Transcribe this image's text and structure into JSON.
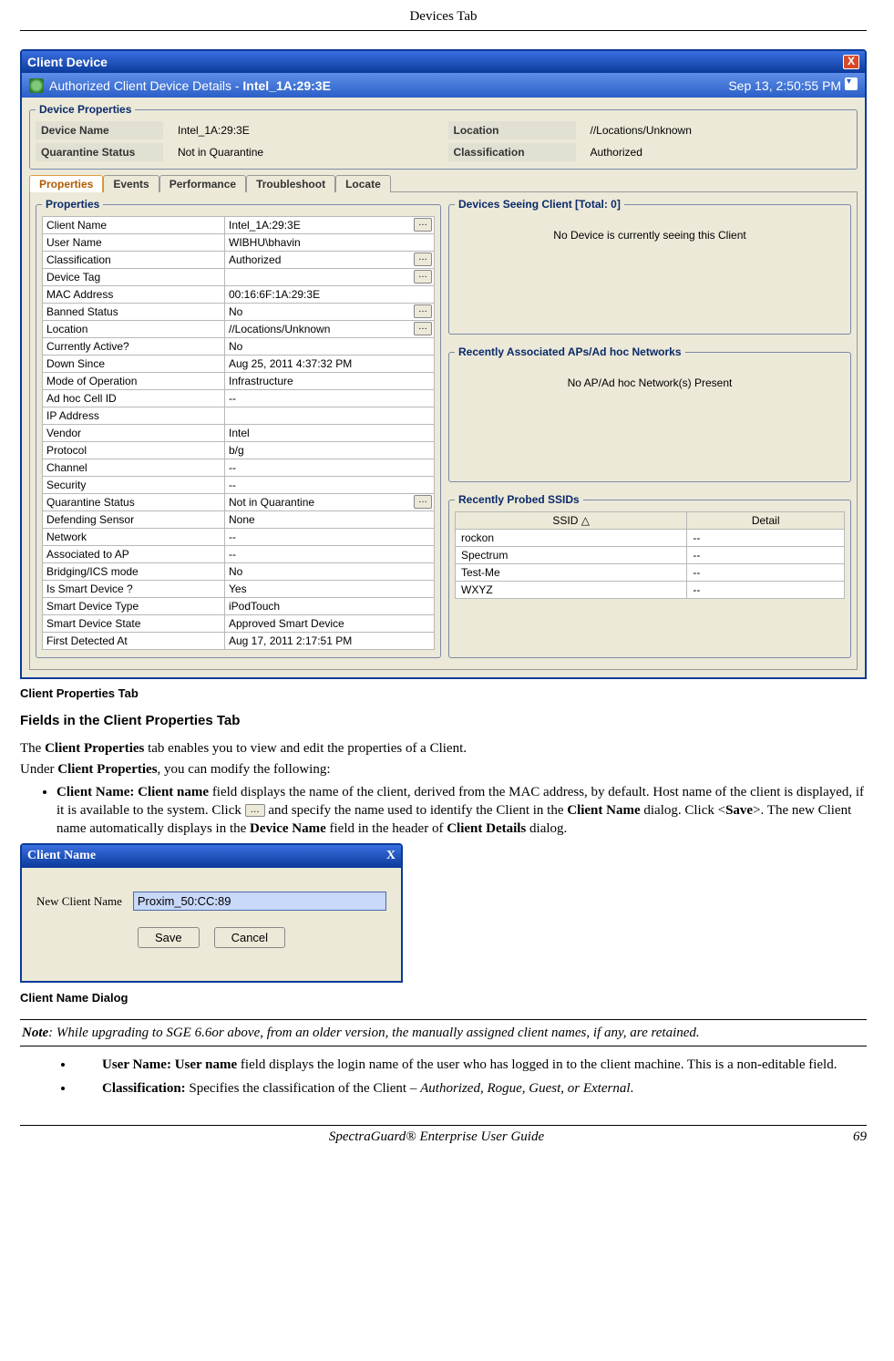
{
  "page": {
    "header": "Devices Tab",
    "footer_center": "SpectraGuard®  Enterprise User Guide",
    "footer_right": "69"
  },
  "window": {
    "title": "Client Device",
    "subtitle_prefix": "Authorized Client Device Details -  ",
    "subtitle_name": "Intel_1A:29:3E",
    "timestamp": "Sep 13, 2:50:55 PM"
  },
  "device_properties": {
    "legend": "Device Properties",
    "device_name_label": "Device Name",
    "device_name_value": "Intel_1A:29:3E",
    "location_label": "Location",
    "location_value": "//Locations/Unknown",
    "quarantine_label": "Quarantine Status",
    "quarantine_value": "Not in Quarantine",
    "classification_label": "Classification",
    "classification_value": "Authorized"
  },
  "tabs": {
    "properties": "Properties",
    "events": "Events",
    "performance": "Performance",
    "troubleshoot": "Troubleshoot",
    "locate": "Locate"
  },
  "properties_panel": {
    "legend": "Properties",
    "rows": [
      {
        "k": "Client Name",
        "v": "Intel_1A:29:3E",
        "btn": true
      },
      {
        "k": "User Name",
        "v": "WIBHU\\bhavin",
        "btn": false
      },
      {
        "k": "Classification",
        "v": "Authorized",
        "btn": true
      },
      {
        "k": "Device Tag",
        "v": "",
        "btn": true
      },
      {
        "k": "MAC Address",
        "v": "00:16:6F:1A:29:3E",
        "btn": false
      },
      {
        "k": "Banned Status",
        "v": "No",
        "btn": true
      },
      {
        "k": "Location",
        "v": "//Locations/Unknown",
        "btn": true
      },
      {
        "k": "Currently Active?",
        "v": "No",
        "btn": false
      },
      {
        "k": "Down Since",
        "v": "Aug 25, 2011 4:37:32 PM",
        "btn": false
      },
      {
        "k": "Mode of Operation",
        "v": "Infrastructure",
        "btn": false
      },
      {
        "k": "Ad hoc Cell ID",
        "v": "--",
        "btn": false
      },
      {
        "k": "IP Address",
        "v": "",
        "btn": false
      },
      {
        "k": "Vendor",
        "v": "Intel",
        "btn": false
      },
      {
        "k": "Protocol",
        "v": "b/g",
        "btn": false
      },
      {
        "k": "Channel",
        "v": "--",
        "btn": false
      },
      {
        "k": "Security",
        "v": "--",
        "btn": false
      },
      {
        "k": "Quarantine Status",
        "v": "Not in Quarantine",
        "btn": true
      },
      {
        "k": "Defending Sensor",
        "v": "None",
        "btn": false
      },
      {
        "k": "Network",
        "v": "--",
        "btn": false
      },
      {
        "k": "Associated to AP",
        "v": "--",
        "btn": false
      },
      {
        "k": "Bridging/ICS mode",
        "v": "No",
        "btn": false
      },
      {
        "k": "Is Smart Device ?",
        "v": "Yes",
        "btn": false
      },
      {
        "k": "Smart Device Type",
        "v": "iPodTouch",
        "btn": false
      },
      {
        "k": "Smart Device State",
        "v": "Approved Smart Device",
        "btn": false
      },
      {
        "k": "First Detected At",
        "v": "Aug 17, 2011 2:17:51 PM",
        "btn": false
      }
    ]
  },
  "devices_seeing": {
    "legend": "Devices Seeing Client [Total: 0]",
    "msg": "No Device is currently seeing this Client"
  },
  "recent_aps": {
    "legend": "Recently Associated APs/Ad hoc Networks",
    "msg": "No AP/Ad hoc Network(s) Present"
  },
  "probed": {
    "legend": "Recently Probed SSIDs",
    "col_ssid": "SSID",
    "col_detail": "Detail",
    "rows": [
      {
        "ssid": "rockon",
        "detail": "--"
      },
      {
        "ssid": "Spectrum",
        "detail": "--"
      },
      {
        "ssid": "Test-Me",
        "detail": "--"
      },
      {
        "ssid": "WXYZ",
        "detail": "--"
      }
    ]
  },
  "doc": {
    "caption1": "Client Properties Tab",
    "heading": "Fields in the Client Properties Tab",
    "para1_a": "The ",
    "para1_b": "Client Properties",
    "para1_c": " tab enables you to view and edit the properties of a Client.",
    "para2_a": "Under ",
    "para2_b": "Client Properties",
    "para2_c": ", you can modify the following:",
    "bullet1_a": "Client Name:  Client name",
    "bullet1_b": " field displays the name of the client, derived from the MAC address, by default. Host name of the client is displayed, if it is available to the system. Click ",
    "bullet1_c": " and specify the name used to identify the Client in the ",
    "bullet1_d": "Client Name",
    "bullet1_e": " dialog. Click <",
    "bullet1_f": "Save",
    "bullet1_g": ">. The new Client name automatically displays in the ",
    "bullet1_h": "Device Name",
    "bullet1_i": " field in the header of ",
    "bullet1_j": "Client Details",
    "bullet1_k": " dialog.",
    "caption2": "Client Name Dialog",
    "note_a": "Note",
    "note_b": ": While upgrading to SGE 6.6or above, from an older version, the manually assigned client names, if any, are retained.",
    "bullet2_a": "User Name:  User name",
    "bullet2_b": " field displays the login name of the user who has logged in to the client machine. This is a non-editable field.",
    "bullet3_a": "Classification:",
    "bullet3_b": " Specifies the classification of the Client – ",
    "bullet3_c": "Authorized",
    "bullet3_d": ", ",
    "bullet3_e": "Rogue, Guest, or External",
    "bullet3_f": "."
  },
  "dialog": {
    "title": "Client Name",
    "label": "New  Client Name",
    "value": "Proxim_50:CC:89",
    "save": "Save",
    "cancel": "Cancel"
  }
}
